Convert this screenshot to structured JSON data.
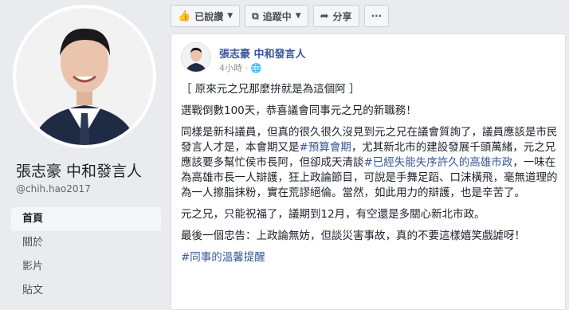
{
  "profile": {
    "name": "張志豪 中和發言人",
    "handle": "@chih.hao2017",
    "nav": [
      "首頁",
      "關於",
      "影片",
      "貼文"
    ]
  },
  "toolbar": {
    "liked_label": "已說讚",
    "follow_label": "追蹤中",
    "share_label": "分享",
    "more_label": "···"
  },
  "post": {
    "author": "張志豪 中和發言人",
    "time": "4小時",
    "line1": "［ 原來元之兄那麼拚就是為這個阿 ］",
    "line2": "選戰倒數100天，恭喜議會同事元之兄的新職務！",
    "p3a": "同樣是新科議員，但真的很久很久沒見到元之兄在議會質詢了，議員應該是市民發言人才是，本會期又是",
    "tag1": "#預算會期",
    "p3b": "，尤其新北市的建設發展千頭萬緒，元之兄應該要多幫忙侯市長阿，但卻成天清談",
    "tag2": "#已經失能失序許久的高雄市政",
    "p3c": "，一味在為高雄市長一人辯護，狂上政論節目，可說是手舞足蹈、口沫橫飛，毫無道理的為一人擦脂抹粉，實在荒謬絕倫。當然，如此用力的辯護，也是辛苦了。",
    "line4": "元之兄，只能祝福了，議期到12月，有空還是多關心新北市政。",
    "line5": "最後一個忠告：上政論無妨，但談災害事故，真的不要這樣嬉笑戲謔呀！",
    "tag3": "#同事的溫馨提醒"
  },
  "colors": {
    "link": "#385898",
    "accent": "#4267b2"
  }
}
